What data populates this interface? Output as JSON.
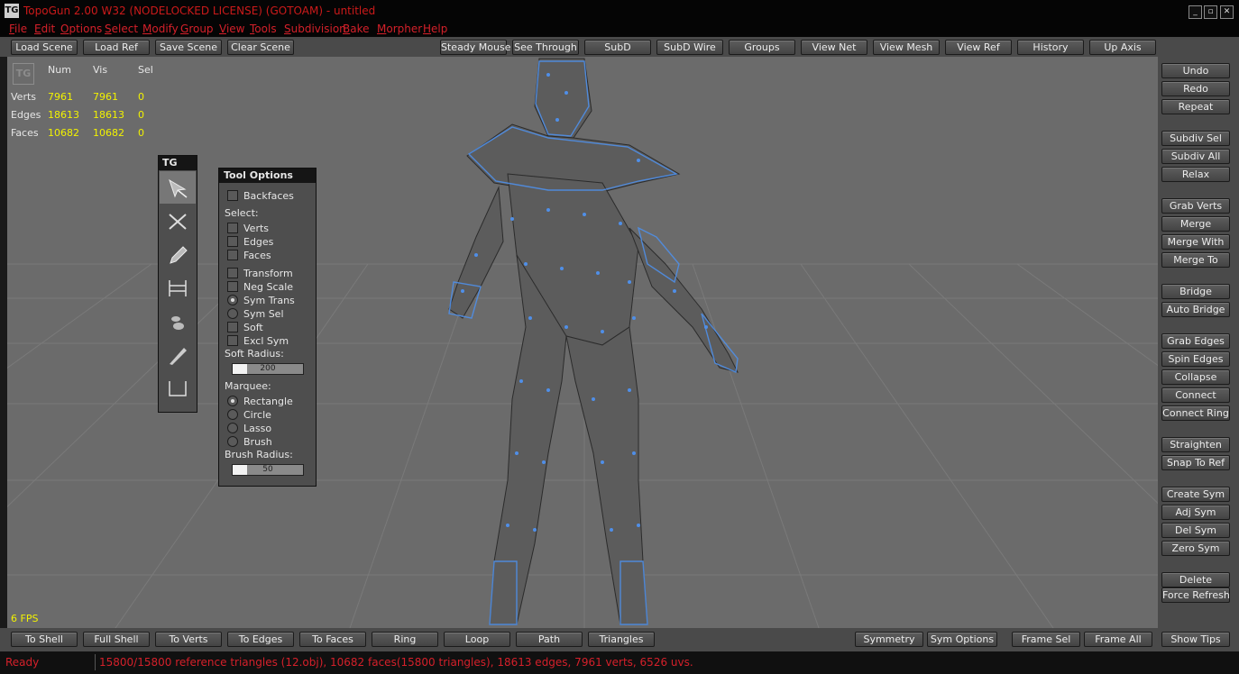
{
  "window": {
    "title": "TopoGun 2.00 W32  (NODELOCKED LICENSE) (GOTOAM) - untitled",
    "icon_text": "TG",
    "controls": [
      "_",
      "▫",
      "✕"
    ]
  },
  "menu": [
    "File",
    "Edit",
    "Options",
    "Select",
    "Modify",
    "Group",
    "View",
    "Tools",
    "Subdivision",
    "Bake",
    "Morpher",
    "Help"
  ],
  "toolbar_left": [
    "Load Scene",
    "Load Ref",
    "Save Scene",
    "Clear Scene"
  ],
  "toolbar_right": [
    "Steady Mouse",
    "See Through",
    "SubD",
    "SubD Wire",
    "Groups",
    "View Net",
    "View Mesh",
    "View Ref",
    "History",
    "Up Axis"
  ],
  "stats": {
    "headers": [
      "Num",
      "Vis",
      "Sel"
    ],
    "rows": [
      {
        "label": "Verts",
        "num": "7961",
        "vis": "7961",
        "sel": "0"
      },
      {
        "label": "Edges",
        "num": "18613",
        "vis": "18613",
        "sel": "0"
      },
      {
        "label": "Faces",
        "num": "10682",
        "vis": "10682",
        "sel": "0"
      }
    ],
    "logo_text": "TG"
  },
  "fps": "6 FPS",
  "tg_palette": {
    "title": "TG",
    "tools": [
      "select-tool-icon",
      "cut-tool-icon",
      "draw-tool-icon",
      "bridge-tool-icon",
      "brush-tool-icon",
      "pen-tool-icon",
      "marquee-tool-icon"
    ],
    "active_index": 0
  },
  "tool_options": {
    "title": "Tool Options",
    "backfaces": "Backfaces",
    "select_label": "Select:",
    "verts": "Verts",
    "edges": "Edges",
    "faces": "Faces",
    "transform": "Transform",
    "neg_scale": "Neg Scale",
    "sym_trans": "Sym Trans",
    "sym_sel": "Sym Sel",
    "soft": "Soft",
    "excl_sym": "Excl Sym",
    "soft_radius_label": "Soft Radius:",
    "soft_radius_value": "200",
    "soft_radius_fraction": 0.2,
    "marquee_label": "Marquee:",
    "rectangle": "Rectangle",
    "circle": "Circle",
    "lasso": "Lasso",
    "brush": "Brush",
    "brush_radius_label": "Brush Radius:",
    "brush_radius_value": "50",
    "brush_radius_fraction": 0.2
  },
  "right_panel": [
    "Undo",
    "Redo",
    "Repeat",
    "Subdiv Sel",
    "Subdiv All",
    "Relax",
    "Grab Verts",
    "Merge",
    "Merge With",
    "Merge To",
    "Bridge",
    "Auto Bridge",
    "Grab Edges",
    "Spin Edges",
    "Collapse",
    "Connect",
    "Connect Ring",
    "Straighten",
    "Snap To Ref",
    "Create Sym",
    "Adj Sym",
    "Del Sym",
    "Zero Sym",
    "Delete",
    "Force Refresh"
  ],
  "bottom_left": [
    "To Shell",
    "Full Shell",
    "To Verts",
    "To Edges",
    "To Faces",
    "Ring",
    "Loop",
    "Path",
    "Triangles"
  ],
  "bottom_right": [
    "Symmetry",
    "Sym Options",
    "Frame Sel",
    "Frame All",
    "Show Tips"
  ],
  "status": {
    "state": "Ready",
    "message": "15800/15800 reference triangles (12.obj), 10682 faces(15800 triangles), 18613 edges, 7961 verts, 6526 uvs."
  },
  "colors": {
    "title_red": "#cc1a1a",
    "stat_yellow": "#f2f200",
    "mesh_blue": "#4f8fe8",
    "viewport_gray": "#6b6b6b"
  }
}
